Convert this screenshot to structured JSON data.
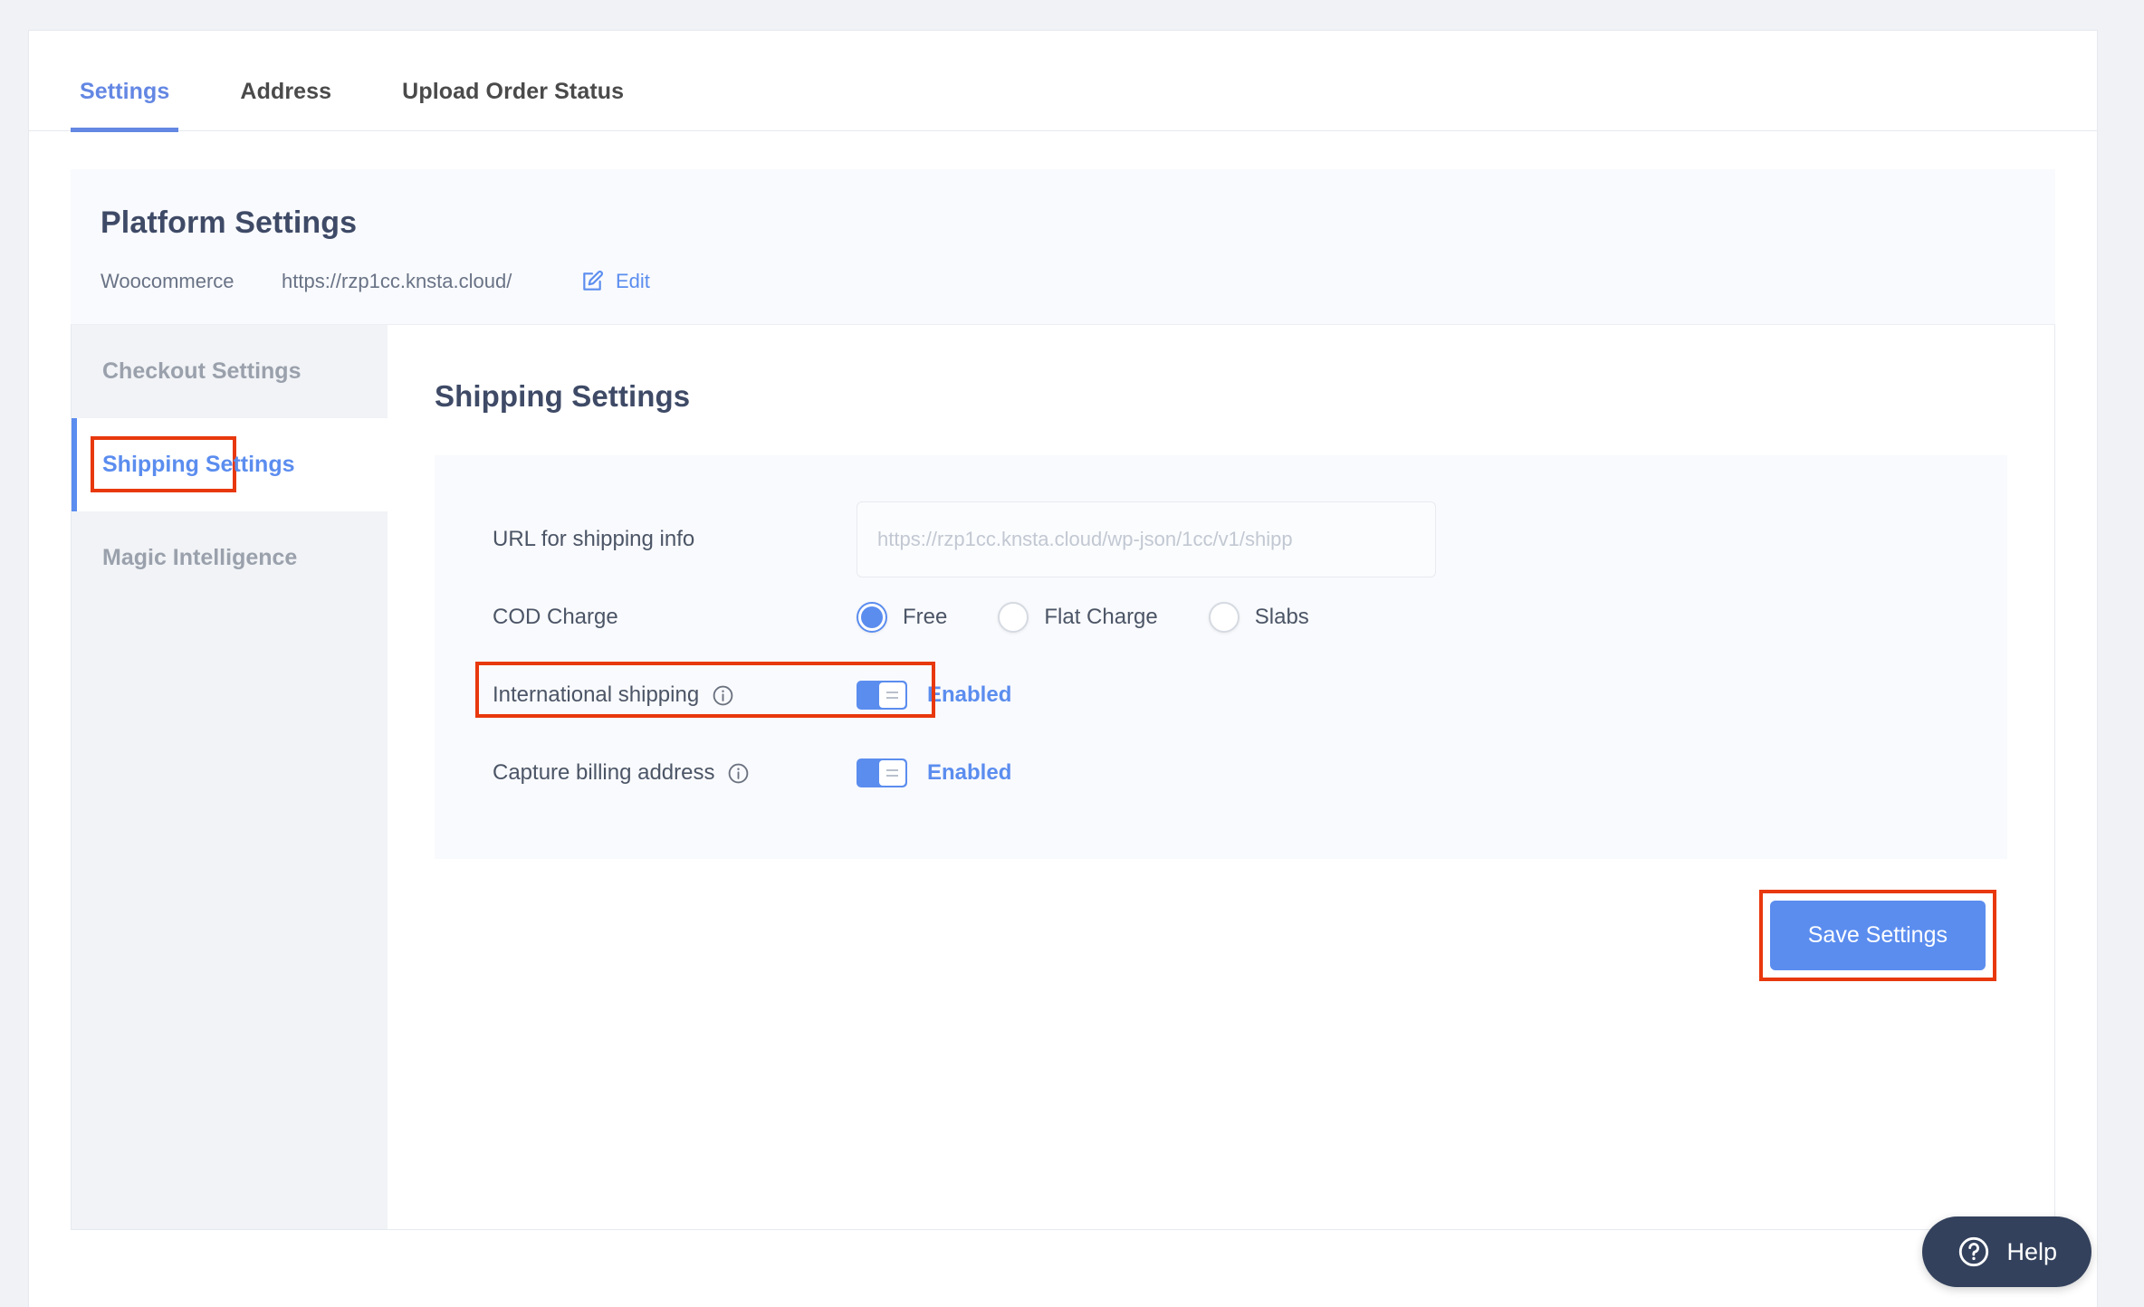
{
  "tabs": [
    {
      "label": "Settings",
      "active": true
    },
    {
      "label": "Address",
      "active": false
    },
    {
      "label": "Upload Order Status",
      "active": false
    }
  ],
  "platform": {
    "title": "Platform Settings",
    "name": "Woocommerce",
    "url": "https://rzp1cc.knsta.cloud/",
    "edit_label": "Edit",
    "edit_icon": "edit-pencil-square-icon"
  },
  "sidebar": {
    "items": [
      {
        "label": "Checkout Settings",
        "active": false,
        "highlighted": false
      },
      {
        "label": "Shipping Settings",
        "active": true,
        "highlighted": true
      },
      {
        "label": "Magic Intelligence",
        "active": false,
        "highlighted": false
      }
    ]
  },
  "main": {
    "title": "Shipping Settings",
    "url_field": {
      "label": "URL for shipping info",
      "value": "",
      "placeholder": "https://rzp1cc.knsta.cloud/wp-json/1cc/v1/shipp"
    },
    "cod_charge": {
      "label": "COD Charge",
      "selected": "Free",
      "options": [
        "Free",
        "Flat Charge",
        "Slabs"
      ]
    },
    "international_shipping": {
      "label": "International shipping",
      "info_icon": "info-circle-icon",
      "state_label": "Enabled",
      "enabled": true,
      "highlighted": true
    },
    "capture_billing_address": {
      "label": "Capture billing address",
      "info_icon": "info-circle-icon",
      "state_label": "Enabled",
      "enabled": true,
      "highlighted": false
    },
    "save_label": "Save Settings"
  },
  "help": {
    "label": "Help",
    "icon": "question-circle-icon"
  },
  "colors": {
    "accent_blue": "#5b8def",
    "tab_blue": "#6387e3",
    "heading_navy": "#3e4a66",
    "highlight_red": "#e8380d",
    "help_navy": "#33415c",
    "panel_bg": "#f9fafd",
    "sidebar_bg": "#f1f3f6",
    "page_bg": "#f0f2f5"
  }
}
